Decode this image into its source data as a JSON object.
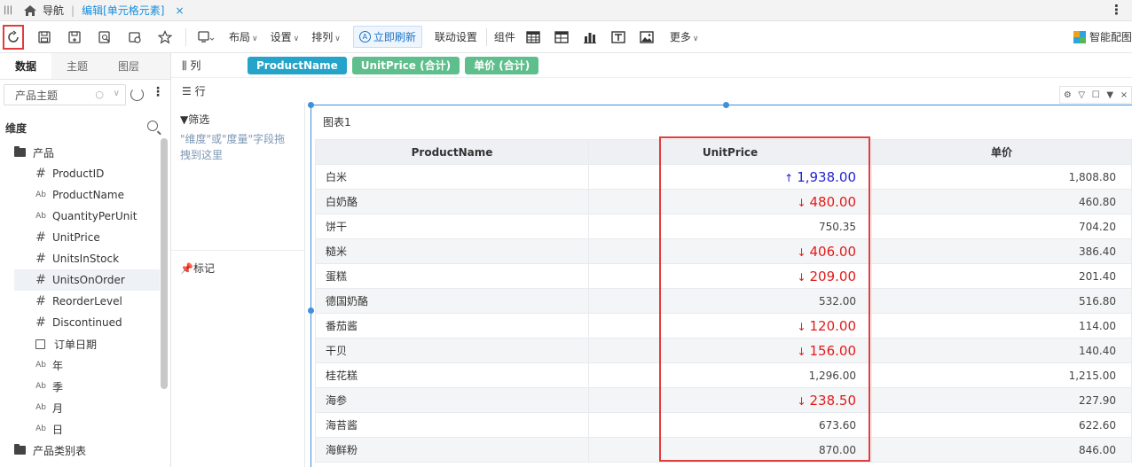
{
  "tabbar": {
    "nav_label": "导航",
    "active_tab": "编辑[单元格元素]",
    "close": "×"
  },
  "toolbar": {
    "layout": "布局",
    "settings": "设置",
    "arrange": "排列",
    "refresh_now": "立即刷新",
    "link_settings": "联动设置",
    "components": "组件",
    "more": "更多",
    "smart_config": "智能配图"
  },
  "left_panel": {
    "tabs": [
      "数据",
      "主题",
      "图层"
    ],
    "topic_select": "产品主题",
    "dimension_header": "维度",
    "tree": [
      {
        "label": "产品",
        "icon": "folder-icon",
        "level": 0
      },
      {
        "label": "ProductID",
        "icon": "number-icon",
        "level": 1
      },
      {
        "label": "ProductName",
        "icon": "text-icon",
        "level": 1
      },
      {
        "label": "QuantityPerUnit",
        "icon": "text-icon",
        "level": 1
      },
      {
        "label": "UnitPrice",
        "icon": "number-icon",
        "level": 1
      },
      {
        "label": "UnitsInStock",
        "icon": "number-icon",
        "level": 1
      },
      {
        "label": "UnitsOnOrder",
        "icon": "number-icon",
        "level": 1
      },
      {
        "label": "ReorderLevel",
        "icon": "number-icon",
        "level": 1
      },
      {
        "label": "Discontinued",
        "icon": "number-icon",
        "level": 1
      },
      {
        "label": "订单日期",
        "icon": "calendar-icon",
        "level": 1
      },
      {
        "label": "年",
        "icon": "text-icon",
        "level": 1
      },
      {
        "label": "季",
        "icon": "text-icon",
        "level": 1
      },
      {
        "label": "月",
        "icon": "text-icon",
        "level": 1
      },
      {
        "label": "日",
        "icon": "text-icon",
        "level": 1
      },
      {
        "label": "产品类别表",
        "icon": "folder-icon",
        "level": 0
      }
    ]
  },
  "fields": {
    "columns_label": "列",
    "rows_label": "行",
    "column_chips": [
      "ProductName",
      "UnitPrice (合计)",
      "单价 (合计)"
    ]
  },
  "filter_panel": {
    "title": "筛选",
    "hint": "\"维度\"或\"度量\"字段拖拽到这里",
    "mark": "标记"
  },
  "chart": {
    "title": "图表1",
    "headers": [
      "ProductName",
      "UnitPrice",
      "单价"
    ],
    "rows": [
      {
        "name": "白米",
        "unit_price": "1,938.00",
        "trend": "up",
        "price": "1,808.80"
      },
      {
        "name": "白奶酪",
        "unit_price": "480.00",
        "trend": "down",
        "price": "460.80"
      },
      {
        "name": "饼干",
        "unit_price": "750.35",
        "trend": "",
        "price": "704.20"
      },
      {
        "name": "糙米",
        "unit_price": "406.00",
        "trend": "down",
        "price": "386.40"
      },
      {
        "name": "蛋糕",
        "unit_price": "209.00",
        "trend": "down",
        "price": "201.40"
      },
      {
        "name": "德国奶酪",
        "unit_price": "532.00",
        "trend": "",
        "price": "516.80"
      },
      {
        "name": "番茄酱",
        "unit_price": "120.00",
        "trend": "down",
        "price": "114.00"
      },
      {
        "name": "干贝",
        "unit_price": "156.00",
        "trend": "down",
        "price": "140.40"
      },
      {
        "name": "桂花糕",
        "unit_price": "1,296.00",
        "trend": "",
        "price": "1,215.00"
      },
      {
        "name": "海参",
        "unit_price": "238.50",
        "trend": "down",
        "price": "227.90"
      },
      {
        "name": "海苔酱",
        "unit_price": "673.60",
        "trend": "",
        "price": "622.60"
      },
      {
        "name": "海鲜粉",
        "unit_price": "870.00",
        "trend": "",
        "price": "846.00"
      }
    ]
  },
  "colors": {
    "accent": "#1a8fdc",
    "highlight_box": "#e23c3c",
    "up": "#2222d2",
    "down": "#e11b1b",
    "chip_blue": "#23a4c8",
    "chip_green": "#5fbf8c"
  }
}
